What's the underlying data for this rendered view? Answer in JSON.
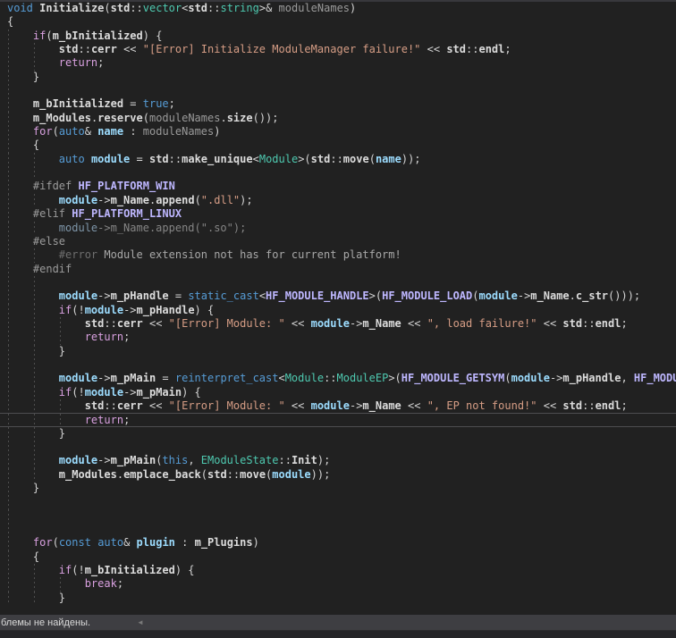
{
  "status_bar": {
    "message": "блемы не найдены.",
    "collapse_icon": "◄"
  },
  "editor": {
    "colors": {
      "background": "#212121",
      "keyword": "#569cd6",
      "control_keyword": "#d8a0df",
      "type": "#4ec9b0",
      "string": "#d69d85",
      "identifier": "#dcdcdc",
      "macro": "#beb7ff",
      "local_variable": "#9cdcfe",
      "parameter": "#9a9a9a",
      "preprocessor": "#9b9b9b",
      "inactive_code": "#858585",
      "current_line_border": "#4d4d50"
    },
    "lines": [
      {
        "indent": 0,
        "guides": 0,
        "tokens": [
          [
            "k",
            "void"
          ],
          [
            "p",
            " "
          ],
          [
            "i",
            "Initialize"
          ],
          [
            "p",
            "("
          ],
          [
            "i",
            "std"
          ],
          [
            "p",
            "::"
          ],
          [
            "t",
            "vector"
          ],
          [
            "p",
            "<"
          ],
          [
            "i",
            "std"
          ],
          [
            "p",
            "::"
          ],
          [
            "t",
            "string"
          ],
          [
            "p",
            ">& "
          ],
          [
            "a",
            "moduleNames"
          ],
          [
            "p",
            ")"
          ]
        ]
      },
      {
        "indent": 0,
        "guides": 0,
        "tokens": [
          [
            "p",
            "{"
          ]
        ]
      },
      {
        "indent": 4,
        "guides": 1,
        "tokens": [
          [
            "c",
            "if"
          ],
          [
            "p",
            "("
          ],
          [
            "i",
            "m_bInitialized"
          ],
          [
            "p",
            ") {"
          ]
        ]
      },
      {
        "indent": 8,
        "guides": 2,
        "tokens": [
          [
            "i",
            "std"
          ],
          [
            "p",
            "::"
          ],
          [
            "i",
            "cerr"
          ],
          [
            "p",
            " << "
          ],
          [
            "s",
            "\"[Error] Initialize ModuleManager failure!\""
          ],
          [
            "p",
            " << "
          ],
          [
            "i",
            "std"
          ],
          [
            "p",
            "::"
          ],
          [
            "i",
            "endl"
          ],
          [
            "p",
            ";"
          ]
        ]
      },
      {
        "indent": 8,
        "guides": 2,
        "tokens": [
          [
            "c",
            "return"
          ],
          [
            "p",
            ";"
          ]
        ]
      },
      {
        "indent": 4,
        "guides": 1,
        "tokens": [
          [
            "p",
            "}"
          ]
        ]
      },
      {
        "indent": 0,
        "guides": 1,
        "tokens": []
      },
      {
        "indent": 4,
        "guides": 1,
        "tokens": [
          [
            "i",
            "m_bInitialized"
          ],
          [
            "p",
            " = "
          ],
          [
            "k",
            "true"
          ],
          [
            "p",
            ";"
          ]
        ]
      },
      {
        "indent": 4,
        "guides": 1,
        "tokens": [
          [
            "i",
            "m_Modules"
          ],
          [
            "p",
            "."
          ],
          [
            "i",
            "reserve"
          ],
          [
            "p",
            "("
          ],
          [
            "a",
            "moduleNames"
          ],
          [
            "p",
            "."
          ],
          [
            "i",
            "size"
          ],
          [
            "p",
            "());"
          ]
        ]
      },
      {
        "indent": 4,
        "guides": 1,
        "tokens": [
          [
            "c",
            "for"
          ],
          [
            "p",
            "("
          ],
          [
            "k",
            "auto"
          ],
          [
            "p",
            "& "
          ],
          [
            "l",
            "name"
          ],
          [
            "p",
            " : "
          ],
          [
            "a",
            "moduleNames"
          ],
          [
            "p",
            ")"
          ]
        ]
      },
      {
        "indent": 4,
        "guides": 1,
        "tokens": [
          [
            "p",
            "{"
          ]
        ]
      },
      {
        "indent": 8,
        "guides": 2,
        "tokens": [
          [
            "k",
            "auto"
          ],
          [
            "p",
            " "
          ],
          [
            "l",
            "module"
          ],
          [
            "p",
            " = "
          ],
          [
            "i",
            "std"
          ],
          [
            "p",
            "::"
          ],
          [
            "i",
            "make_unique"
          ],
          [
            "p",
            "<"
          ],
          [
            "t",
            "Module"
          ],
          [
            "p",
            ">("
          ],
          [
            "i",
            "std"
          ],
          [
            "p",
            "::"
          ],
          [
            "i",
            "move"
          ],
          [
            "p",
            "("
          ],
          [
            "l",
            "name"
          ],
          [
            "p",
            "));"
          ]
        ]
      },
      {
        "indent": 0,
        "guides": 2,
        "tokens": []
      },
      {
        "indent": 4,
        "guides": 1,
        "tokens": [
          [
            "d",
            "#ifdef "
          ],
          [
            "m",
            "HF_PLATFORM_WIN"
          ]
        ]
      },
      {
        "indent": 8,
        "guides": 2,
        "tokens": [
          [
            "l",
            "module"
          ],
          [
            "p",
            "->"
          ],
          [
            "i",
            "m_Name"
          ],
          [
            "p",
            "."
          ],
          [
            "i",
            "append"
          ],
          [
            "p",
            "("
          ],
          [
            "s",
            "\".dll\""
          ],
          [
            "p",
            ");"
          ]
        ]
      },
      {
        "indent": 4,
        "guides": 1,
        "tokens": [
          [
            "d",
            "#elif "
          ],
          [
            "m",
            "HF_PLATFORM_LINUX"
          ]
        ]
      },
      {
        "indent": 8,
        "guides": 2,
        "tokens": [
          [
            "xl",
            "module"
          ],
          [
            "x",
            "->m_Name.append("
          ],
          [
            "x",
            "\".so\""
          ],
          [
            "x",
            ");"
          ]
        ]
      },
      {
        "indent": 4,
        "guides": 1,
        "tokens": [
          [
            "d",
            "#else"
          ]
        ]
      },
      {
        "indent": 8,
        "guides": 2,
        "tokens": [
          [
            "e",
            "#error"
          ],
          [
            "w",
            " Module extension not has for current platform!"
          ]
        ]
      },
      {
        "indent": 4,
        "guides": 1,
        "tokens": [
          [
            "d",
            "#endif"
          ]
        ]
      },
      {
        "indent": 0,
        "guides": 2,
        "tokens": []
      },
      {
        "indent": 8,
        "guides": 2,
        "tokens": [
          [
            "l",
            "module"
          ],
          [
            "p",
            "->"
          ],
          [
            "i",
            "m_pHandle"
          ],
          [
            "p",
            " = "
          ],
          [
            "k",
            "static_cast"
          ],
          [
            "p",
            "<"
          ],
          [
            "m",
            "HF_MODULE_HANDLE"
          ],
          [
            "p",
            ">("
          ],
          [
            "m",
            "HF_MODULE_LOAD"
          ],
          [
            "p",
            "("
          ],
          [
            "l",
            "module"
          ],
          [
            "p",
            "->"
          ],
          [
            "i",
            "m_Name"
          ],
          [
            "p",
            "."
          ],
          [
            "i",
            "c_str"
          ],
          [
            "p",
            "()));"
          ]
        ]
      },
      {
        "indent": 8,
        "guides": 2,
        "tokens": [
          [
            "c",
            "if"
          ],
          [
            "p",
            "(!"
          ],
          [
            "l",
            "module"
          ],
          [
            "p",
            "->"
          ],
          [
            "i",
            "m_pHandle"
          ],
          [
            "p",
            ") {"
          ]
        ]
      },
      {
        "indent": 12,
        "guides": 3,
        "tokens": [
          [
            "i",
            "std"
          ],
          [
            "p",
            "::"
          ],
          [
            "i",
            "cerr"
          ],
          [
            "p",
            " << "
          ],
          [
            "s",
            "\"[Error] Module: \""
          ],
          [
            "p",
            " << "
          ],
          [
            "l",
            "module"
          ],
          [
            "p",
            "->"
          ],
          [
            "i",
            "m_Name"
          ],
          [
            "p",
            " << "
          ],
          [
            "s",
            "\", load failure!\""
          ],
          [
            "p",
            " << "
          ],
          [
            "i",
            "std"
          ],
          [
            "p",
            "::"
          ],
          [
            "i",
            "endl"
          ],
          [
            "p",
            ";"
          ]
        ]
      },
      {
        "indent": 12,
        "guides": 3,
        "tokens": [
          [
            "c",
            "return"
          ],
          [
            "p",
            ";"
          ]
        ]
      },
      {
        "indent": 8,
        "guides": 2,
        "tokens": [
          [
            "p",
            "}"
          ]
        ]
      },
      {
        "indent": 0,
        "guides": 2,
        "tokens": []
      },
      {
        "indent": 8,
        "guides": 2,
        "tokens": [
          [
            "l",
            "module"
          ],
          [
            "p",
            "->"
          ],
          [
            "i",
            "m_pMain"
          ],
          [
            "p",
            " = "
          ],
          [
            "k",
            "reinterpret_cast"
          ],
          [
            "p",
            "<"
          ],
          [
            "t",
            "Module"
          ],
          [
            "p",
            "::"
          ],
          [
            "t",
            "ModuleEP"
          ],
          [
            "p",
            ">("
          ],
          [
            "m",
            "HF_MODULE_GETSYM"
          ],
          [
            "p",
            "("
          ],
          [
            "l",
            "module"
          ],
          [
            "p",
            "->"
          ],
          [
            "i",
            "m_pHandle"
          ],
          [
            "p",
            ", "
          ],
          [
            "m",
            "HF_MODULE_CALLBACK"
          ]
        ]
      },
      {
        "indent": 8,
        "guides": 2,
        "tokens": [
          [
            "c",
            "if"
          ],
          [
            "p",
            "(!"
          ],
          [
            "l",
            "module"
          ],
          [
            "p",
            "->"
          ],
          [
            "i",
            "m_pMain"
          ],
          [
            "p",
            ") {"
          ]
        ]
      },
      {
        "indent": 12,
        "guides": 3,
        "tokens": [
          [
            "i",
            "std"
          ],
          [
            "p",
            "::"
          ],
          [
            "i",
            "cerr"
          ],
          [
            "p",
            " << "
          ],
          [
            "s",
            "\"[Error] Module: \""
          ],
          [
            "p",
            " << "
          ],
          [
            "l",
            "module"
          ],
          [
            "p",
            "->"
          ],
          [
            "i",
            "m_Name"
          ],
          [
            "p",
            " << "
          ],
          [
            "s",
            "\", EP not found!\""
          ],
          [
            "p",
            " << "
          ],
          [
            "i",
            "std"
          ],
          [
            "p",
            "::"
          ],
          [
            "i",
            "endl"
          ],
          [
            "p",
            ";"
          ]
        ]
      },
      {
        "indent": 12,
        "guides": 3,
        "current": true,
        "tokens": [
          [
            "c",
            "return"
          ],
          [
            "p",
            ";"
          ]
        ]
      },
      {
        "indent": 8,
        "guides": 2,
        "tokens": [
          [
            "p",
            "}"
          ]
        ]
      },
      {
        "indent": 0,
        "guides": 2,
        "tokens": []
      },
      {
        "indent": 8,
        "guides": 2,
        "tokens": [
          [
            "l",
            "module"
          ],
          [
            "p",
            "->"
          ],
          [
            "i",
            "m_pMain"
          ],
          [
            "p",
            "("
          ],
          [
            "k",
            "this"
          ],
          [
            "p",
            ", "
          ],
          [
            "t",
            "EModuleState"
          ],
          [
            "p",
            "::"
          ],
          [
            "i",
            "Init"
          ],
          [
            "p",
            ");"
          ]
        ]
      },
      {
        "indent": 8,
        "guides": 2,
        "tokens": [
          [
            "i",
            "m_Modules"
          ],
          [
            "p",
            "."
          ],
          [
            "i",
            "emplace_back"
          ],
          [
            "p",
            "("
          ],
          [
            "i",
            "std"
          ],
          [
            "p",
            "::"
          ],
          [
            "i",
            "move"
          ],
          [
            "p",
            "("
          ],
          [
            "l",
            "module"
          ],
          [
            "p",
            "));"
          ]
        ]
      },
      {
        "indent": 4,
        "guides": 1,
        "tokens": [
          [
            "p",
            "}"
          ]
        ]
      },
      {
        "indent": 0,
        "guides": 1,
        "tokens": []
      },
      {
        "indent": 0,
        "guides": 1,
        "tokens": []
      },
      {
        "indent": 0,
        "guides": 1,
        "tokens": []
      },
      {
        "indent": 4,
        "guides": 1,
        "tokens": [
          [
            "c",
            "for"
          ],
          [
            "p",
            "("
          ],
          [
            "k",
            "const"
          ],
          [
            "p",
            " "
          ],
          [
            "k",
            "auto"
          ],
          [
            "p",
            "& "
          ],
          [
            "l",
            "plugin"
          ],
          [
            "p",
            " : "
          ],
          [
            "i",
            "m_Plugins"
          ],
          [
            "p",
            ")"
          ]
        ]
      },
      {
        "indent": 4,
        "guides": 1,
        "tokens": [
          [
            "p",
            "{"
          ]
        ]
      },
      {
        "indent": 8,
        "guides": 2,
        "tokens": [
          [
            "c",
            "if"
          ],
          [
            "p",
            "(!"
          ],
          [
            "i",
            "m_bInitialized"
          ],
          [
            "p",
            ") {"
          ]
        ]
      },
      {
        "indent": 12,
        "guides": 3,
        "tokens": [
          [
            "c",
            "break"
          ],
          [
            "p",
            ";"
          ]
        ]
      },
      {
        "indent": 8,
        "guides": 2,
        "tokens": [
          [
            "p",
            "}"
          ]
        ]
      }
    ]
  }
}
